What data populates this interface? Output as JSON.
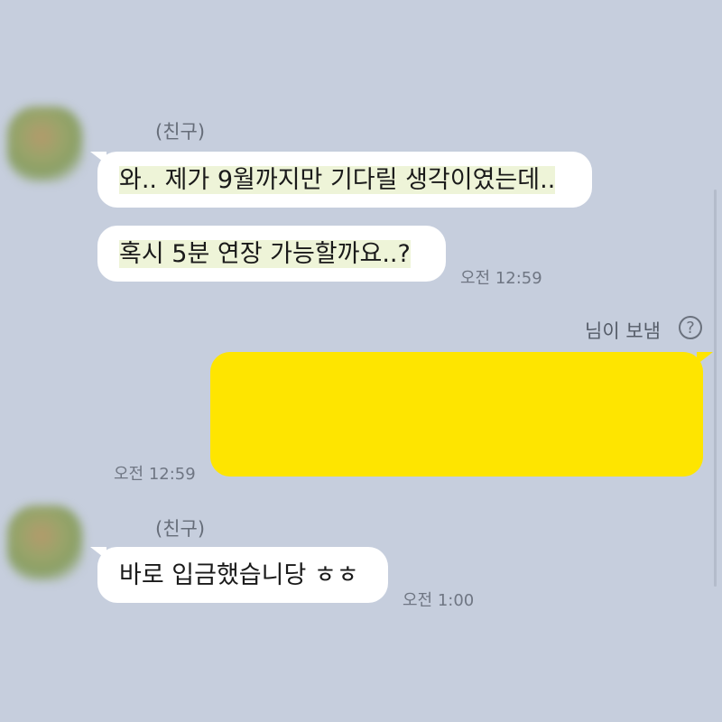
{
  "messages": {
    "first_group": {
      "sender": "(친구)",
      "bubble1": "와.. 제가 9월까지만 기다릴 생각이였는데..",
      "bubble2": "혹시 5분 연장 가능할까요..?",
      "time": "오전 12:59"
    },
    "sent_group": {
      "label": "님이 보냄",
      "help_icon_symbol": "?",
      "time": "오전 12:59",
      "bubble_color": "#fee500"
    },
    "second_group": {
      "sender": "(친구)",
      "bubble": "바로 입금했습니당 ㅎㅎ",
      "time": "오전 1:00"
    }
  },
  "colors": {
    "background": "#c6cedd",
    "received_bubble": "#ffffff",
    "sent_bubble": "#fee500"
  }
}
